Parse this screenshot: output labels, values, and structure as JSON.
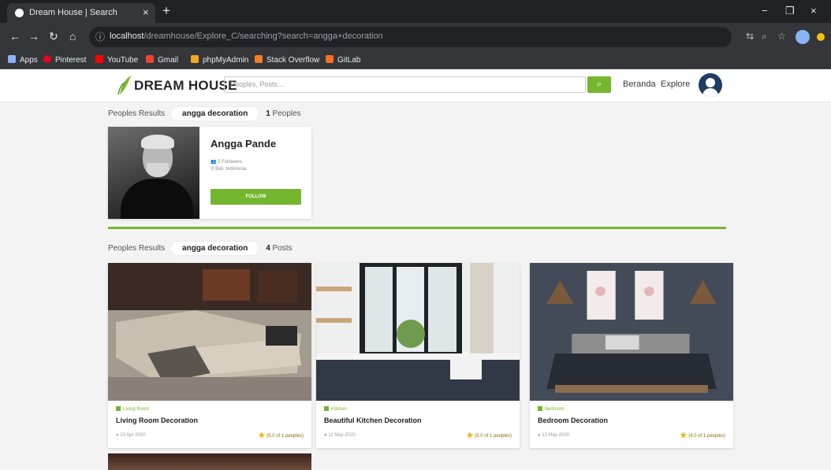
{
  "browser": {
    "tab_title": "Dream House | Search",
    "tab_close": "×",
    "new_tab": "+",
    "url_host": "localhost",
    "url_path": "/dreamhouse/Explore_C/searching?search=angga+decoration",
    "window_controls": [
      "−",
      "❐",
      "×"
    ],
    "bookmarks": [
      {
        "label": "Apps",
        "color": "#8ab4f8"
      },
      {
        "label": "Pinterest",
        "color": "#e60023"
      },
      {
        "label": "YouTube",
        "color": "#ff0000"
      },
      {
        "label": "Gmail",
        "color": "#ea4335"
      },
      {
        "label": "phpMyAdmin",
        "color": "#f5a623"
      },
      {
        "label": "Stack Overflow",
        "color": "#f48024"
      },
      {
        "label": "GitLab",
        "color": "#fc6d26"
      }
    ]
  },
  "site": {
    "logo": "DREAM HOUSE",
    "search_placeholder": "Peoples, Posts...",
    "search_icon": "search-icon",
    "nav": {
      "home": "Beranda",
      "explore": "Explore"
    },
    "accent": "#74b72e"
  },
  "people_results": {
    "label": "Peoples Results",
    "query": "angga decoration",
    "count": "1",
    "count_label": "Peoples",
    "person": {
      "name": "Angga Pande",
      "meta1": "2 Followers",
      "meta2": "Bali, Indonesia",
      "follow_label": "FOLLOW"
    }
  },
  "post_results": {
    "label": "Peoples Results",
    "query": "angga decoration",
    "count": "4",
    "count_label": "Posts",
    "posts": [
      {
        "category": "Living Room",
        "title": "Living Room Decoration",
        "date": "10 Apr 2020",
        "rating": "(5.0 of 1 peoples)"
      },
      {
        "category": "Kitchen",
        "title": "Beautiful Kitchen Decoration",
        "date": "11 May 2020",
        "rating": "(5.0 of 1 peoples)"
      },
      {
        "category": "Bedroom",
        "title": "Bedroom Decoration",
        "date": "13 May 2020",
        "rating": "(4.0 of 1 peoples)"
      }
    ]
  }
}
